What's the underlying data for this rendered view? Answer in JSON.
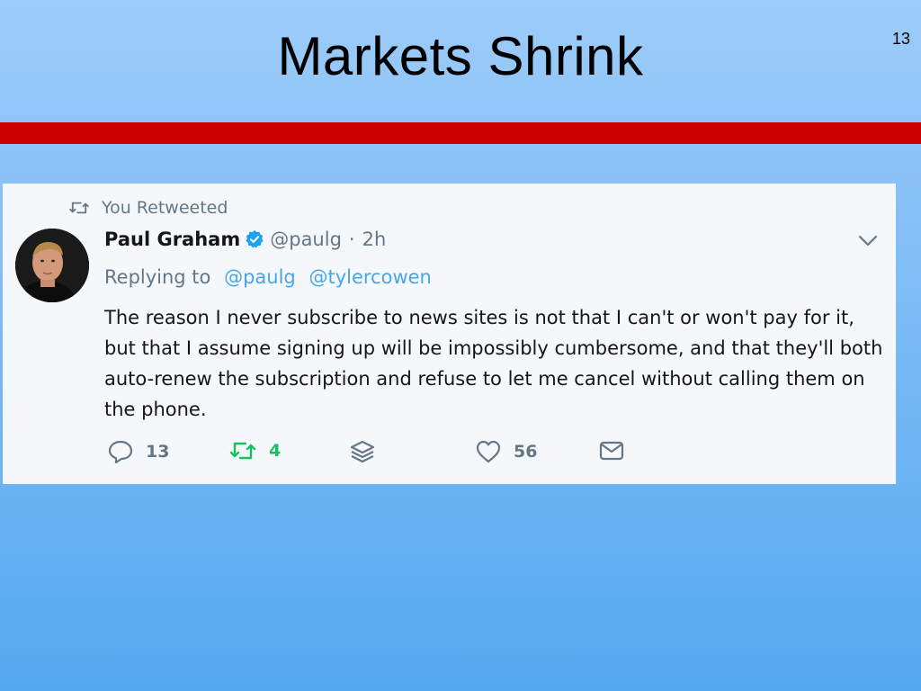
{
  "slide": {
    "title": "Markets Shrink",
    "page_number": "13",
    "accent_bar_color": "#cc0000"
  },
  "tweet": {
    "retweet_label": "You Retweeted",
    "author": {
      "display_name": "Paul Graham",
      "handle": "@paulg",
      "verified": true,
      "time": "2h"
    },
    "separator": "·",
    "replying_to_label": "Replying to",
    "replying_to": [
      "@paulg",
      "@tylercowen"
    ],
    "text_lines": [
      "The reason I never subscribe to news sites is not that I can't or won't pay for it,",
      "but that I assume signing up will be impossibly cumbersome, and that they'll both",
      "auto-renew the subscription and refuse to let me cancel without calling them on",
      "the phone."
    ],
    "actions": {
      "reply_count": "13",
      "retweet_count": "4",
      "retweet_active_color": "#17bf63",
      "like_count": "56"
    },
    "icons": [
      "retweet-icon",
      "verified-badge-icon",
      "chevron-down-icon",
      "reply-icon",
      "layers-icon",
      "heart-icon",
      "mail-icon"
    ]
  }
}
